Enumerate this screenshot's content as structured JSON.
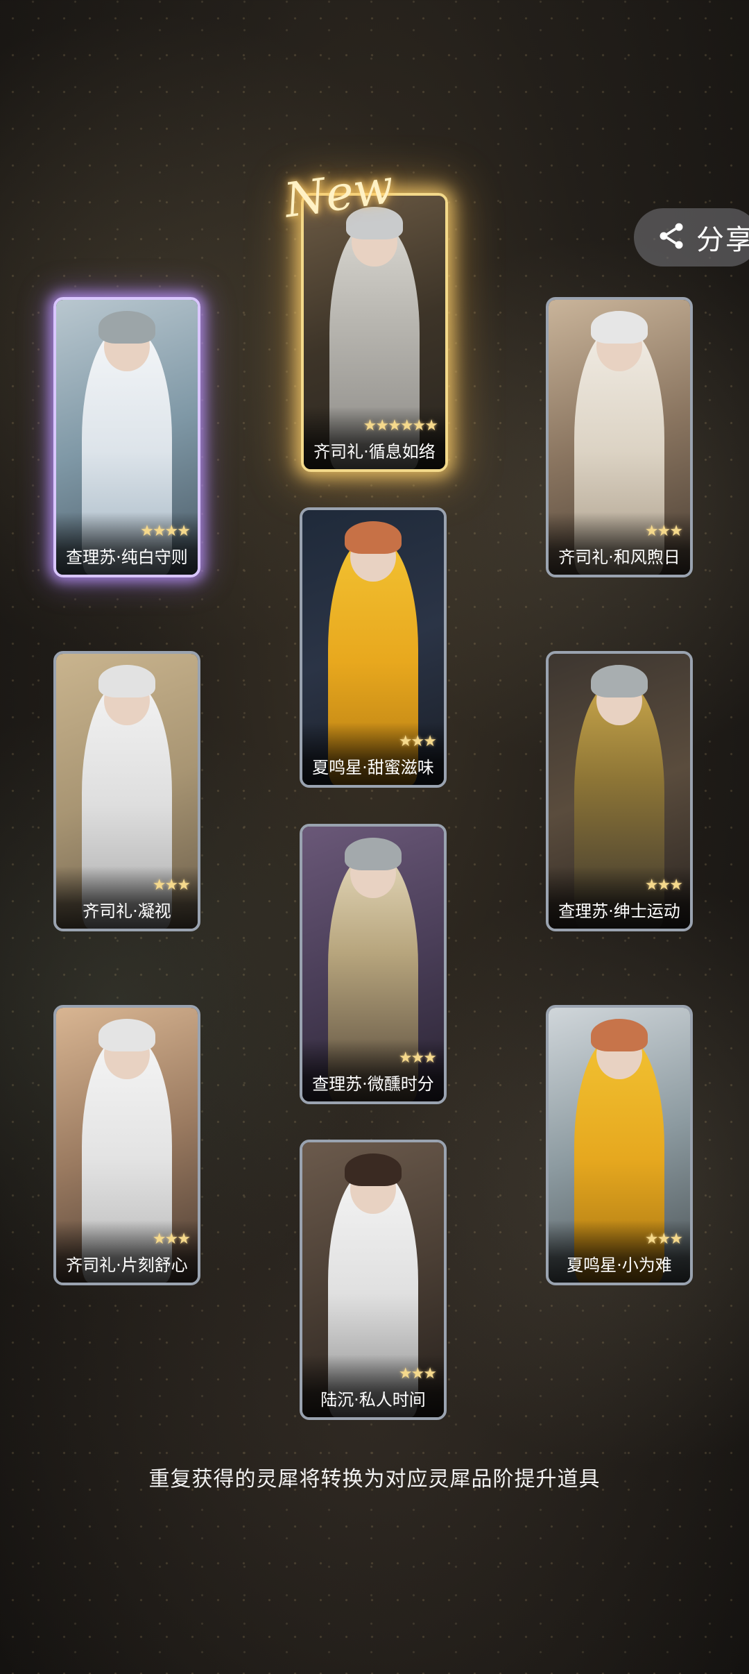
{
  "share": {
    "label": "分享",
    "icon": "share-icon"
  },
  "new_tag": "New",
  "cards": [
    {
      "name": "齐司礼·循息如络",
      "stars": 6,
      "highlight": "gold",
      "is_new": true
    },
    {
      "name": "查理苏·纯白守则",
      "stars": 4,
      "highlight": "purple"
    },
    {
      "name": "齐司礼·和风煦日",
      "stars": 3,
      "highlight": "none"
    },
    {
      "name": "夏鸣星·甜蜜滋味",
      "stars": 3,
      "highlight": "none"
    },
    {
      "name": "齐司礼·凝视",
      "stars": 3,
      "highlight": "none"
    },
    {
      "name": "查理苏·绅士运动",
      "stars": 3,
      "highlight": "none"
    },
    {
      "name": "查理苏·微醺时分",
      "stars": 3,
      "highlight": "none"
    },
    {
      "name": "齐司礼·片刻舒心",
      "stars": 3,
      "highlight": "none"
    },
    {
      "name": "夏鸣星·小为难",
      "stars": 3,
      "highlight": "none"
    },
    {
      "name": "陆沉·私人时间",
      "stars": 3,
      "highlight": "none"
    }
  ],
  "footer_note": "重复获得的灵犀将转换为对应灵犀品阶提升道具",
  "colors": {
    "gold_glow": "#f3d98a",
    "purple_glow": "#d9c6ff",
    "card_border": "#9aa3b0",
    "star": "#f5d98c"
  }
}
